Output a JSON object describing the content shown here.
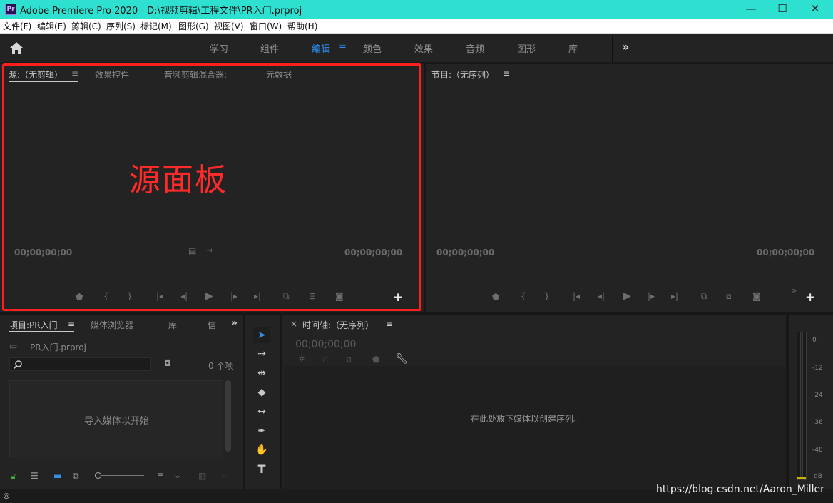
{
  "window": {
    "app_icon": "Pr",
    "title": "Adobe Premiere Pro 2020 - D:\\视频剪辑\\工程文件\\PR入门.prproj",
    "minimize": "—",
    "maximize": "☐",
    "close": "✕"
  },
  "menu": [
    "文件(F)",
    "编辑(E)",
    "剪辑(C)",
    "序列(S)",
    "标记(M)",
    "图形(G)",
    "视图(V)",
    "窗口(W)",
    "帮助(H)"
  ],
  "workspaces": {
    "tabs": [
      "学习",
      "组件",
      "编辑",
      "颜色",
      "效果",
      "音频",
      "图形",
      "库"
    ],
    "active": "编辑",
    "more": "»"
  },
  "source_panel": {
    "tabs": [
      "源:（无剪辑）",
      "效果控件",
      "音频剪辑混合器:",
      "元数据"
    ],
    "menu_glyph": "≡",
    "timecode_left": "00;00;00;00",
    "timecode_right": "00;00;00;00",
    "annotation": "源面板"
  },
  "program_panel": {
    "title": "节目:（无序列）",
    "menu_glyph": "≡",
    "timecode_left": "00;00;00;00",
    "timecode_right": "00;00;00;00",
    "more": "»"
  },
  "project_panel": {
    "tabs": [
      "项目:PR入门",
      "媒体浏览器",
      "库",
      "信"
    ],
    "menu_glyph": "≡",
    "more": "»",
    "file": "PR入门.prproj",
    "count": "0 个项",
    "empty_msg": "导入媒体以开始"
  },
  "timeline_panel": {
    "close": "×",
    "title": "时间轴:（无序列）",
    "menu_glyph": "≡",
    "timecode": "00;00;00;00",
    "empty_msg": "在此处放下媒体以创建序列。"
  },
  "audio_meter": {
    "scale": [
      "0",
      "-12",
      "-24",
      "-36",
      "-48",
      "dB"
    ]
  },
  "watermark": "https://blog.csdn.net/Aaron_Miller",
  "colors": {
    "accent_blue": "#2d8ceb",
    "titlebar": "#2ee0d0",
    "annotation_red": "#ff1f1f",
    "panel_bg": "#232323"
  }
}
